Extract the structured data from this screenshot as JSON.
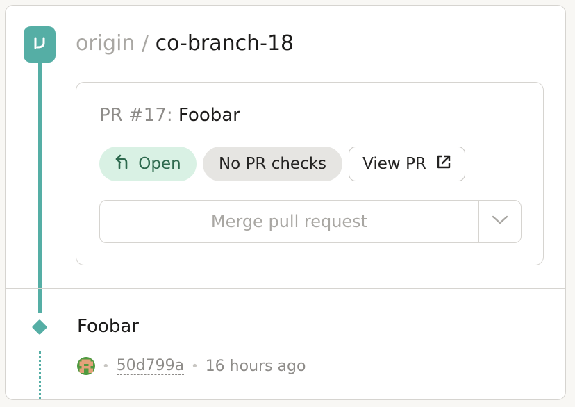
{
  "branch": {
    "remote": "origin",
    "separator": "/",
    "name": "co-branch-18"
  },
  "pull_request": {
    "number_label": "PR #17:",
    "title": "Foobar",
    "status_label": "Open",
    "checks_label": "No PR checks",
    "view_label": "View PR",
    "merge_label": "Merge pull request"
  },
  "commit": {
    "message": "Foobar",
    "sha": "50d799a",
    "time": "16 hours ago",
    "separator": "•"
  },
  "icons": {
    "branch": "pull-request-icon",
    "open": "pr-open-icon",
    "external": "external-link-icon",
    "caret": "chevron-down-icon",
    "avatar": "pixel-avatar"
  },
  "colors": {
    "accent": "#55aea5",
    "open_bg": "#d9f1e4",
    "open_text": "#2e6a4e",
    "muted": "#8e8c89"
  }
}
